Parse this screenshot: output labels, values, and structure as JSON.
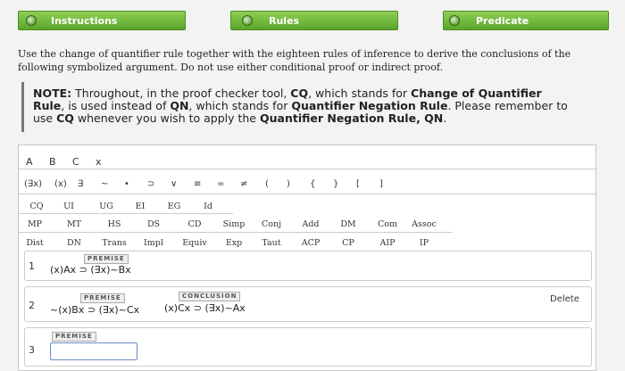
{
  "tabs": [
    {
      "label": "Instructions",
      "icon": "gear-icon"
    },
    {
      "label": "Rules",
      "icon": "gear-icon"
    },
    {
      "label": "Predicate",
      "icon": "check-icon"
    }
  ],
  "intro": "Use the change of quantifier rule together with the eighteen rules of inference to derive the conclusions of the following symbolized argument. Do not use either conditional proof or indirect proof.",
  "note": {
    "lead": "NOTE:",
    "t1": " Throughout, in the proof checker tool, ",
    "b1": "CQ",
    "t2": ", which stands for ",
    "b2": "Change of Quantifier Rule",
    "t3": ", is used instead of ",
    "b3": "QN",
    "t4": ", which stands for ",
    "b4": "Quantifier Negation Rule",
    "t5": ". Please remember to use ",
    "b5": "CQ",
    "t6": " whenever you wish to apply the ",
    "b6": "Quantifier Negation Rule, QN",
    "t7": "."
  },
  "letters": [
    "A",
    "B",
    "C",
    "x"
  ],
  "symbols": [
    "(∃x)",
    "(x)",
    "∃",
    "~",
    "•",
    "⊃",
    "∨",
    "≡",
    "=",
    "≠",
    "(",
    ")",
    "{",
    "}",
    "[",
    "]"
  ],
  "rules_row1": [
    "CQ",
    "UI",
    "UG",
    "EI",
    "EG",
    "Id"
  ],
  "rules_row2": [
    "MP",
    "MT",
    "HS",
    "DS",
    "CD",
    "Simp",
    "Conj",
    "Add",
    "DM",
    "Com",
    "Assoc"
  ],
  "rules_row3": [
    "Dist",
    "DN",
    "Trans",
    "Impl",
    "Equiv",
    "Exp",
    "Taut",
    "ACP",
    "CP",
    "AIP",
    "IP"
  ],
  "proof": {
    "line1": {
      "num": "1",
      "tag": "PREMISE",
      "formula": "(x)Ax ⊃ (∃x)~Bx"
    },
    "line2": {
      "num": "2",
      "tag": "PREMISE",
      "formula": "~(x)Bx ⊃ (∃x)~Cx",
      "conc_tag": "CONCLUSION",
      "conclusion": "(x)Cx ⊃ (∃x)~Ax",
      "delete": "Delete"
    },
    "line3": {
      "num": "3",
      "tag": "PREMISE",
      "value": ""
    }
  }
}
